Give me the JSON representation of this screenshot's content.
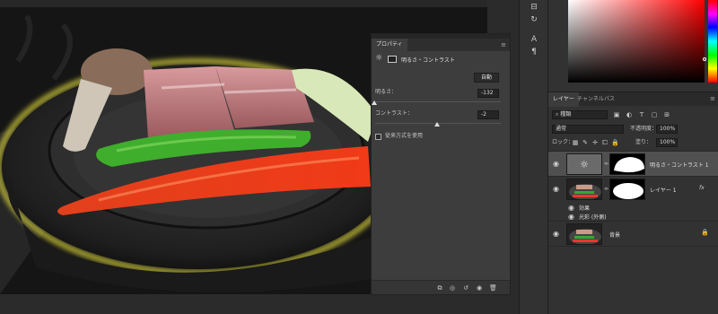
{
  "properties_panel": {
    "tab_label": "プロパティ",
    "adjustment_title": "明るさ・コントラスト",
    "auto_button": "自動",
    "brightness_label": "明るさ：",
    "brightness_value": "-132",
    "contrast_label": "コントラスト：",
    "contrast_value": "-2",
    "legacy_label": "従来方式を使用",
    "legacy_checked": false
  },
  "layers_panel": {
    "tabs": [
      "レイヤー",
      "チャンネル",
      "パス"
    ],
    "active_tab": "レイヤー",
    "filter_kind": "種類",
    "blend_mode": "通常",
    "opacity_label": "不透明度：",
    "opacity_value": "100%",
    "lock_label": "ロック：",
    "fill_label": "塗り：",
    "fill_value": "100%",
    "layers": [
      {
        "name": "明るさ・コントラスト 1",
        "type": "adjustment",
        "selected": true
      },
      {
        "name": "レイヤー 1",
        "type": "pixel",
        "fx": "fx",
        "effects_label": "効果",
        "effect_item": "光彩 (外側)"
      },
      {
        "name": "背景",
        "type": "background",
        "locked": true
      }
    ]
  },
  "colors": {
    "canvas_glow": "#e6e03c",
    "color_field_hue": "#ff0000",
    "selected_layer": "#505050"
  },
  "icons": [
    "sun-icon",
    "eye-icon",
    "chain-icon",
    "lock-icon",
    "trash-icon",
    "search-icon"
  ]
}
